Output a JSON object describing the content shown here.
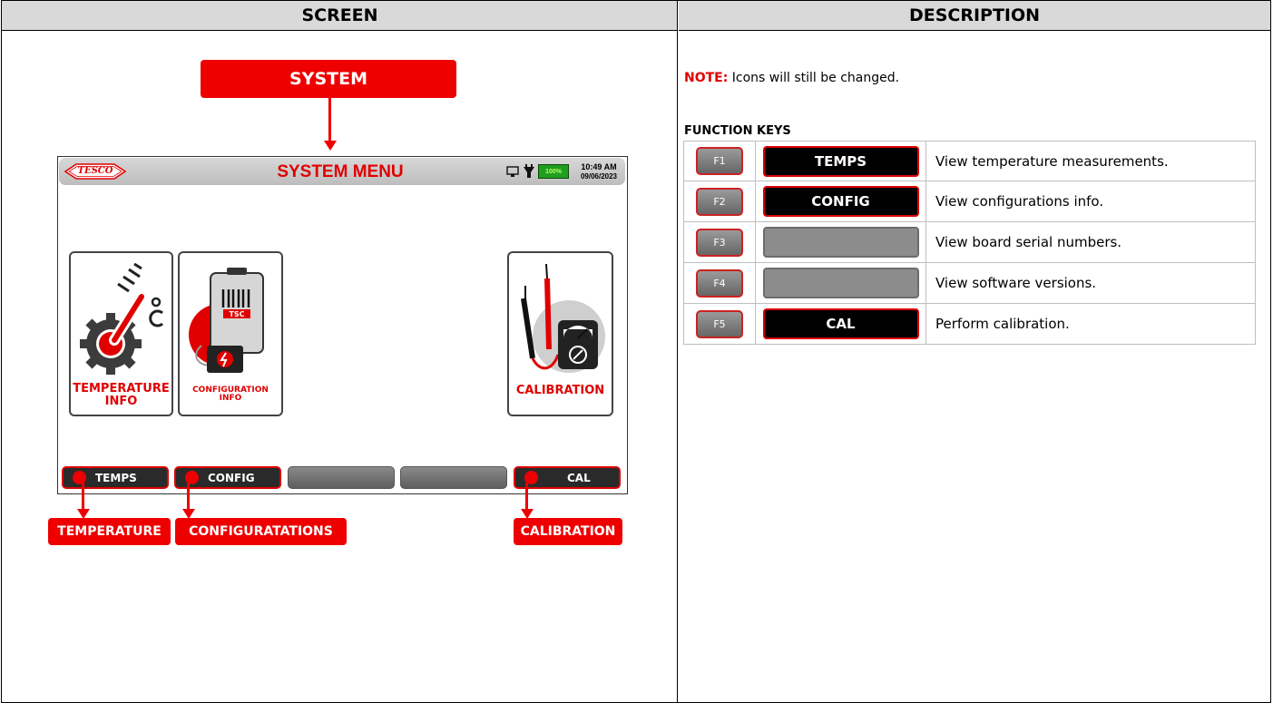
{
  "columns": {
    "screen": "SCREEN",
    "description": "DESCRIPTION"
  },
  "callouts": {
    "system": "SYSTEM",
    "temperature": "TEMPERATURE",
    "configurations": "CONFIGURATATIONS",
    "calibration": "CALIBRATION"
  },
  "device": {
    "logo": "TESCO",
    "title": "SYSTEM MENU",
    "battery": "100%",
    "time": "10:49 AM",
    "date": "09/06/2023",
    "tiles": [
      {
        "label_1": "TEMPERATURE",
        "label_2": "INFO",
        "icon": "thermometer-gear-icon"
      },
      {
        "label_1": "CONFIGURATION",
        "label_2": "INFO",
        "icon": "meter-battery-icon"
      },
      {
        "label_1": "CALIBRATION",
        "label_2": "",
        "icon": "multimeter-icon"
      }
    ],
    "softkeys": [
      "TEMPS",
      "CONFIG",
      "",
      "",
      "CAL"
    ]
  },
  "description": {
    "note_label": "NOTE:",
    "note_text": " Icons will still be changed.",
    "section_title": "FUNCTION KEYS",
    "rows": [
      {
        "key": "F1",
        "button": "TEMPS",
        "desc": "View temperature measurements."
      },
      {
        "key": "F2",
        "button": "CONFIG",
        "desc": "View configurations info."
      },
      {
        "key": "F3",
        "button": "",
        "desc": "View board serial numbers."
      },
      {
        "key": "F4",
        "button": "",
        "desc": "View software versions."
      },
      {
        "key": "F5",
        "button": "CAL",
        "desc": "Perform calibration."
      }
    ]
  },
  "colors": {
    "accent": "#ee0000",
    "header_bg": "#d9d9d9",
    "battery": "#1f9e1f"
  }
}
